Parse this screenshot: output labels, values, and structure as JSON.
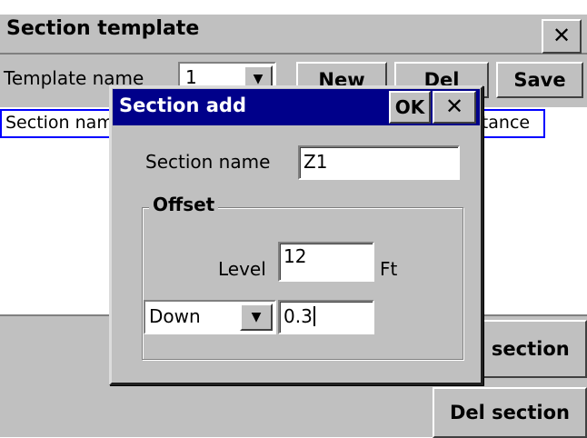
{
  "main_window": {
    "title": "Section template",
    "close_glyph": "✕",
    "template_name_label": "Template name",
    "template_name_value": "1",
    "dropdown_glyph": "▼",
    "buttons": {
      "new": "New",
      "del": "Del",
      "save": "Save"
    },
    "columns": {
      "name": "Section name",
      "distance": "Distance"
    },
    "add_section_label": "Add section",
    "del_section_label": "Del section"
  },
  "dialog": {
    "title": "Section add",
    "ok_label": "OK",
    "close_glyph": "✕",
    "section_name_label": "Section name",
    "section_name_value": "Z1",
    "offset_legend": "Offset",
    "level_label": "Level",
    "level_value": "12",
    "level_unit": "Ft",
    "direction_value": "Down",
    "dropdown_glyph": "▼",
    "offset_value": "0.3"
  }
}
